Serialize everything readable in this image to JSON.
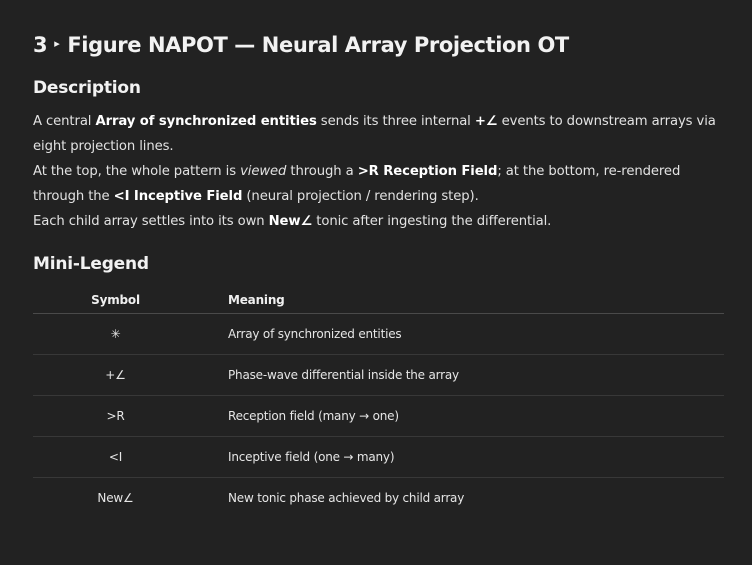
{
  "heading": {
    "number": "3",
    "marker": "▸",
    "title": "Figure NAPOT — Neural Array Projection OT"
  },
  "description": {
    "heading": "Description",
    "p1": {
      "t1": "A central ",
      "b1": "Array of synchronized entities",
      "t2": " sends its three internal ",
      "b2": "+∠",
      "t3": " events to downstream arrays via eight projection lines."
    },
    "p2": {
      "t1": "At the top, the whole pattern is ",
      "em1": "viewed",
      "t2": " through a ",
      "b1": ">R Reception Field",
      "t3": "; at the bottom, re-rendered through the ",
      "b2": "<I Inceptive Field",
      "t4": " (neural projection / rendering step)."
    },
    "p3": {
      "t1": "Each child array settles into its own ",
      "b1": "New∠",
      "t2": " tonic after ingesting the differential."
    }
  },
  "legend": {
    "heading": "Mini-Legend",
    "columns": [
      "Symbol",
      "Meaning"
    ],
    "rows": [
      {
        "symbol": "✳",
        "meaning": "Array of synchronized entities"
      },
      {
        "symbol": "+∠",
        "meaning": "Phase-wave differential inside the array"
      },
      {
        "symbol": ">R",
        "meaning": "Reception field (many → one)"
      },
      {
        "symbol": "<I",
        "meaning": "Inceptive field (one → many)"
      },
      {
        "symbol": "New∠",
        "meaning": "New tonic phase achieved by child array"
      }
    ]
  }
}
